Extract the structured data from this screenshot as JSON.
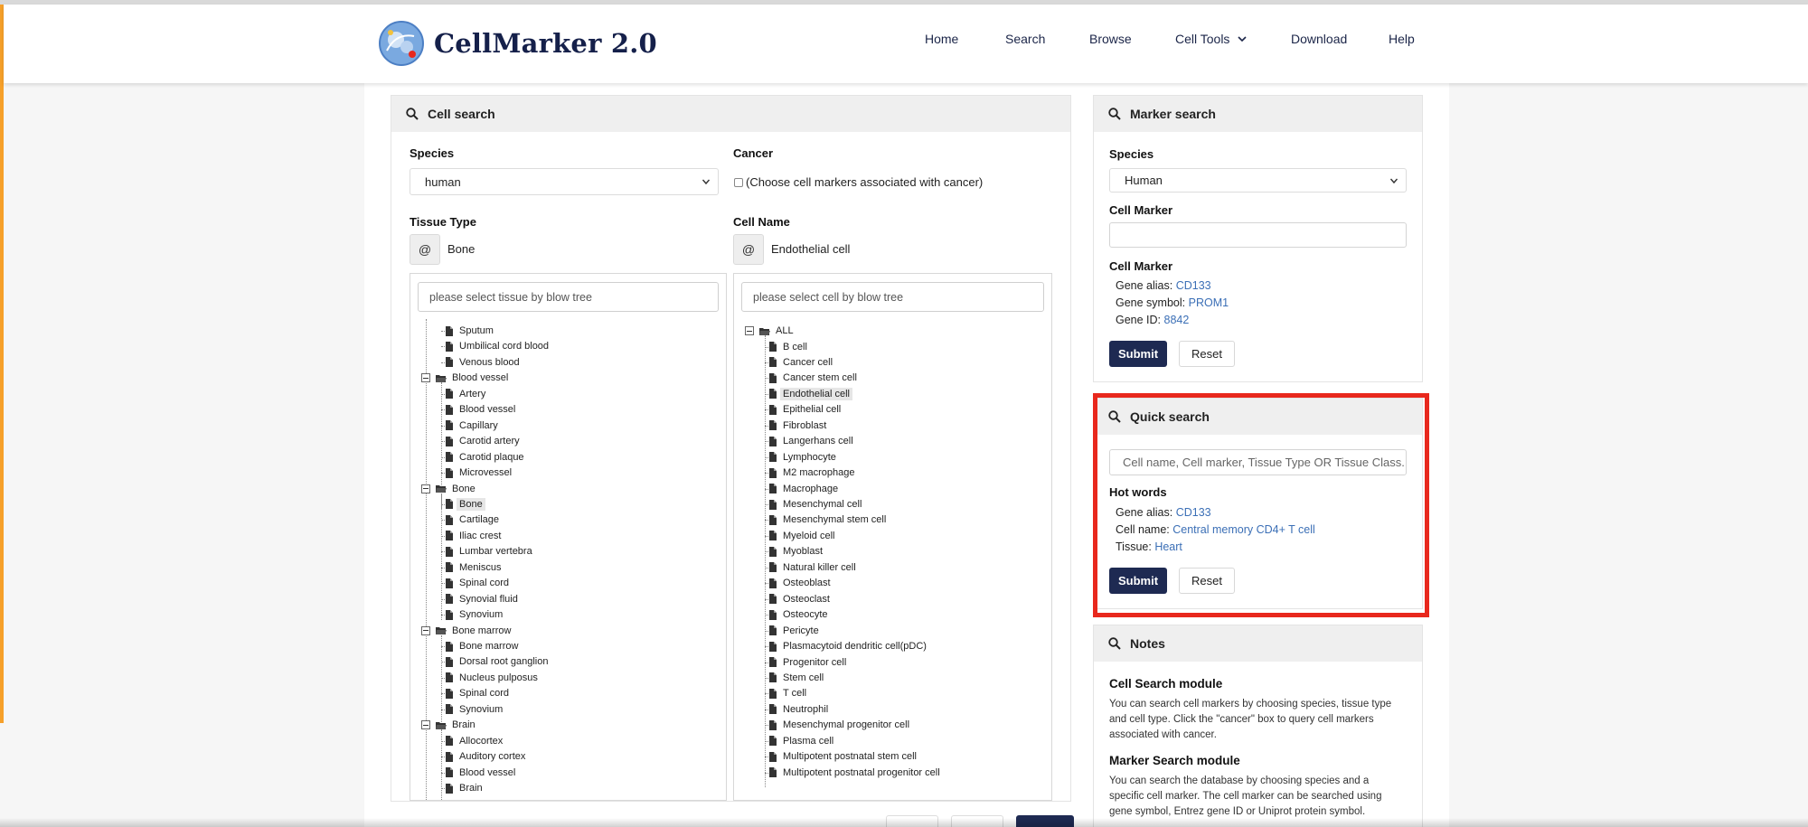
{
  "header": {
    "logo_text": "CellMarker 2.0",
    "nav": [
      {
        "label": "Home"
      },
      {
        "label": "Search"
      },
      {
        "label": "Browse"
      },
      {
        "label": "Cell Tools"
      },
      {
        "label": "Download"
      },
      {
        "label": "Help"
      }
    ]
  },
  "cell_search": {
    "title": "Cell search",
    "species_label": "Species",
    "species_value": "human",
    "cancer_label": "Cancer",
    "cancer_checkbox_text": "(Choose cell markers associated with cancer)",
    "tissue_label": "Tissue Type",
    "tissue_value": "Bone",
    "cellname_label": "Cell Name",
    "cellname_value": "Endothelial cell",
    "at_symbol": "@",
    "tissue_search_placeholder": "please select tissue by blow tree",
    "cell_search_placeholder": "please select cell by blow tree",
    "tissue_tree": [
      {
        "label": "Sputum",
        "type": "leaf"
      },
      {
        "label": "Umbilical cord blood",
        "type": "leaf"
      },
      {
        "label": "Venous blood",
        "type": "leaf"
      },
      {
        "label": "Blood vessel",
        "type": "folder"
      },
      {
        "label": "Artery",
        "type": "leaf"
      },
      {
        "label": "Blood vessel",
        "type": "leaf"
      },
      {
        "label": "Capillary",
        "type": "leaf"
      },
      {
        "label": "Carotid artery",
        "type": "leaf"
      },
      {
        "label": "Carotid plaque",
        "type": "leaf"
      },
      {
        "label": "Microvessel",
        "type": "leaf"
      },
      {
        "label": "Bone",
        "type": "folder"
      },
      {
        "label": "Bone",
        "type": "leaf",
        "selected": true
      },
      {
        "label": "Cartilage",
        "type": "leaf"
      },
      {
        "label": "Iliac crest",
        "type": "leaf"
      },
      {
        "label": "Lumbar vertebra",
        "type": "leaf"
      },
      {
        "label": "Meniscus",
        "type": "leaf"
      },
      {
        "label": "Spinal cord",
        "type": "leaf"
      },
      {
        "label": "Synovial fluid",
        "type": "leaf"
      },
      {
        "label": "Synovium",
        "type": "leaf"
      },
      {
        "label": "Bone marrow",
        "type": "folder"
      },
      {
        "label": "Bone marrow",
        "type": "leaf"
      },
      {
        "label": "Dorsal root ganglion",
        "type": "leaf"
      },
      {
        "label": "Nucleus pulposus",
        "type": "leaf"
      },
      {
        "label": "Spinal cord",
        "type": "leaf"
      },
      {
        "label": "Synovium",
        "type": "leaf"
      },
      {
        "label": "Brain",
        "type": "folder"
      },
      {
        "label": "Allocortex",
        "type": "leaf"
      },
      {
        "label": "Auditory cortex",
        "type": "leaf"
      },
      {
        "label": "Blood vessel",
        "type": "leaf"
      },
      {
        "label": "Brain",
        "type": "leaf"
      }
    ],
    "cell_tree_root": "ALL",
    "cell_tree": [
      {
        "label": "B cell"
      },
      {
        "label": "Cancer cell"
      },
      {
        "label": "Cancer stem cell"
      },
      {
        "label": "Endothelial cell",
        "selected": true
      },
      {
        "label": "Epithelial cell"
      },
      {
        "label": "Fibroblast"
      },
      {
        "label": "Langerhans cell"
      },
      {
        "label": "Lymphocyte"
      },
      {
        "label": "M2 macrophage"
      },
      {
        "label": "Macrophage"
      },
      {
        "label": "Mesenchymal cell"
      },
      {
        "label": "Mesenchymal stem cell"
      },
      {
        "label": "Myeloid cell"
      },
      {
        "label": "Myoblast"
      },
      {
        "label": "Natural killer cell"
      },
      {
        "label": "Osteoblast"
      },
      {
        "label": "Osteoclast"
      },
      {
        "label": "Osteocyte"
      },
      {
        "label": "Pericyte"
      },
      {
        "label": "Plasmacytoid dendritic cell(pDC)"
      },
      {
        "label": "Progenitor cell"
      },
      {
        "label": "Stem cell"
      },
      {
        "label": "T cell"
      },
      {
        "label": "Neutrophil"
      },
      {
        "label": "Mesenchymal progenitor cell"
      },
      {
        "label": "Plasma cell"
      },
      {
        "label": "Multipotent postnatal stem cell"
      },
      {
        "label": "Multipotent postnatal progenitor cell"
      }
    ]
  },
  "marker_search": {
    "title": "Marker search",
    "species_label": "Species",
    "species_value": "Human",
    "cell_marker_label": "Cell Marker",
    "cell_marker_value": "",
    "examples_label": "Cell Marker",
    "examples": [
      {
        "key": "Gene alias:",
        "value": "CD133"
      },
      {
        "key": "Gene symbol:",
        "value": "PROM1"
      },
      {
        "key": "Gene ID:",
        "value": "8842"
      }
    ],
    "submit": "Submit",
    "reset": "Reset"
  },
  "quick_search": {
    "title": "Quick search",
    "placeholder": "Cell name, Cell marker, Tissue Type OR Tissue Class.",
    "hot_words_label": "Hot words",
    "hot_words": [
      {
        "key": "Gene alias:",
        "value": "CD133"
      },
      {
        "key": "Cell name:",
        "value": "Central memory CD4+ T cell"
      },
      {
        "key": "Tissue:",
        "value": "Heart"
      }
    ],
    "submit": "Submit",
    "reset": "Reset",
    "highlight_color": "#e8281d"
  },
  "notes": {
    "title": "Notes",
    "sections": [
      {
        "heading": "Cell Search module",
        "lines": [
          "You can search cell markers by choosing species, tissue type",
          "and cell type. Click the \"cancer\" box to query cell markers",
          "associated with cancer."
        ]
      },
      {
        "heading": "Marker Search module",
        "lines": [
          "You can search the database by choosing species and a",
          "specific cell marker. The cell marker can be searched using",
          "gene symbol, Entrez gene ID or Uniprot protein symbol."
        ]
      }
    ]
  },
  "colors": {
    "primary": "#1e2a52",
    "link": "#3b6fb6",
    "accent_edge": "#f6a02a"
  }
}
